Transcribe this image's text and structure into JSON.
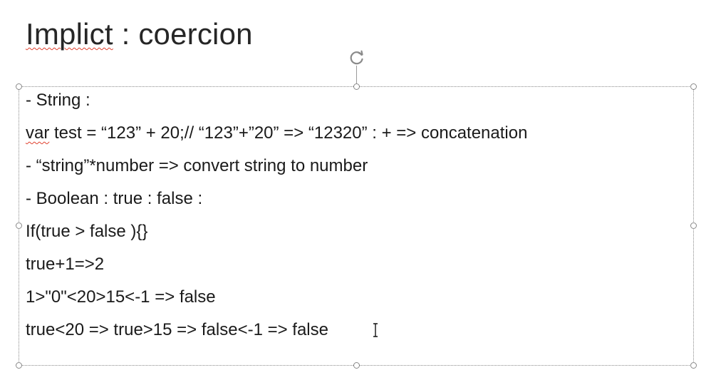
{
  "slide": {
    "title_squiggle": "Implict",
    "title_rest": " : coercion",
    "lines": [
      {
        "prefix": "- ",
        "text": " String :"
      },
      {
        "prefix": "",
        "var_word": "var",
        "text": "  test = “123” + 20;// “123”+”20” => “12320” : + => concatenation"
      },
      {
        "prefix": "- ",
        "text": " “string”*number => convert string to number"
      },
      {
        "prefix": "- ",
        "text": " Boolean : true : false :"
      },
      {
        "prefix": "",
        "text": "If(true > false ){}"
      },
      {
        "prefix": "",
        "text": "true+1=>2"
      },
      {
        "prefix": "",
        "text": "1>\"0\"<20>15<-1 => false"
      },
      {
        "prefix": "",
        "text": "true<20 => true>15 => false<-1 => false"
      }
    ]
  },
  "colors": {
    "title": "#262626",
    "body_text": "#1a1a1a",
    "spellcheck": "#e0412f",
    "selection_border": "#8a8a8a"
  },
  "icons": {
    "rotate": "rotate-handle-icon",
    "cursor": "text-cursor-icon"
  }
}
